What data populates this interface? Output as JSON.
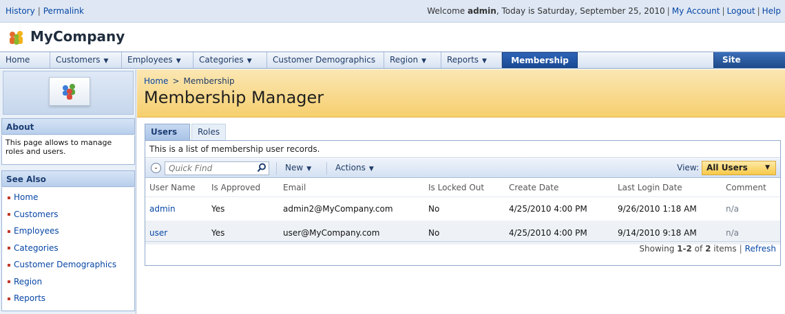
{
  "topbar": {
    "history": "History",
    "permalink": "Permalink",
    "welcome_prefix": "Welcome",
    "user": "admin",
    "date_text": ", Today is Saturday, September 25, 2010",
    "my_account": "My Account",
    "logout": "Logout",
    "help": "Help"
  },
  "brand": {
    "title": "MyCompany"
  },
  "nav": {
    "items": [
      {
        "label": "Home",
        "has_menu": false
      },
      {
        "label": "Customers",
        "has_menu": true
      },
      {
        "label": "Employees",
        "has_menu": true
      },
      {
        "label": "Categories",
        "has_menu": true
      },
      {
        "label": "Customer Demographics",
        "has_menu": false
      },
      {
        "label": "Region",
        "has_menu": true
      },
      {
        "label": "Reports",
        "has_menu": true
      },
      {
        "label": "Membership",
        "has_menu": false,
        "active": true
      }
    ],
    "site_actions": "Site Actions"
  },
  "sidebar": {
    "about_title": "About",
    "about_text": "This page allows to manage roles and users.",
    "see_also_title": "See Also",
    "links": [
      "Home",
      "Customers",
      "Employees",
      "Categories",
      "Customer Demographics",
      "Region",
      "Reports"
    ]
  },
  "page": {
    "breadcrumb": [
      "Home",
      "Membership"
    ],
    "breadcrumb_sep": ">",
    "title": "Membership Manager"
  },
  "tabs": {
    "users": "Users",
    "roles": "Roles"
  },
  "grid": {
    "description": "This is a list of membership user records.",
    "quick_find_placeholder": "Quick Find",
    "new_label": "New",
    "actions_label": "Actions",
    "view_label": "View:",
    "view_value": "All Users",
    "columns": [
      "User Name",
      "Is Approved",
      "Email",
      "Is Locked Out",
      "Create Date",
      "Last Login Date",
      "Comment"
    ],
    "rows": [
      [
        "admin",
        "Yes",
        "admin2@MyCompany.com",
        "No",
        "4/25/2010 4:00 PM",
        "9/26/2010 1:18 AM",
        "n/a"
      ],
      [
        "user",
        "Yes",
        "user@MyCompany.com",
        "No",
        "4/25/2010 4:00 PM",
        "9/14/2010 9:18 AM",
        "n/a"
      ]
    ],
    "footer_showing": "Showing",
    "footer_range": "1-2",
    "footer_of": "of",
    "footer_total": "2",
    "footer_items": "items",
    "refresh": "Refresh"
  },
  "colors": {
    "nav_active": "#1a4a94",
    "header_band": "#f6cf6e",
    "link": "#0645a5"
  }
}
